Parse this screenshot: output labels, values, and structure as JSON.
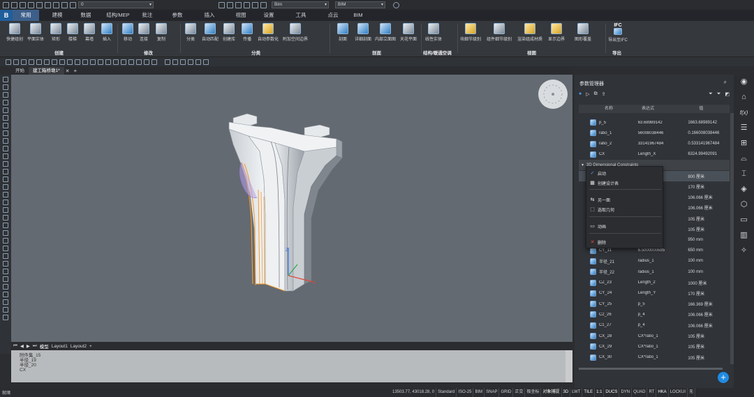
{
  "qat": {
    "layer_value": "0",
    "bim_value": "Bim",
    "workspace_value": "BIM"
  },
  "menu_tabs": [
    {
      "label": "常用",
      "active": true
    },
    {
      "label": "建模"
    },
    {
      "label": "数据"
    },
    {
      "label": "结构/MEP"
    },
    {
      "label": "批注"
    },
    {
      "label": "参数"
    },
    {
      "label": "插入"
    },
    {
      "label": "视图"
    },
    {
      "label": "设置"
    },
    {
      "label": "工具"
    },
    {
      "label": "点云"
    },
    {
      "label": "BIM"
    }
  ],
  "ribbon": {
    "buttons": [
      "快捷组创",
      "平面实体",
      "矩形",
      "楼梯",
      "幕墙",
      "插入",
      "移动",
      "连接",
      "复制",
      "分类",
      "自动匹配",
      "创建库",
      "传播",
      "自动参数化",
      "附加空间边界",
      "剖面",
      "详细剖面",
      "内部立面图",
      "天花平面",
      "线性实体",
      "块细节级别",
      "组件细节级别",
      "渲染组成材质",
      "显示边界",
      "图形覆盖",
      "导出至IFC"
    ],
    "groups": [
      "创建",
      "修改",
      "分类",
      "剖面",
      "结构/暖通空调",
      "视图",
      "导出"
    ],
    "ifc_label": "IFC"
  },
  "doc_tabs": [
    {
      "label": "开始"
    },
    {
      "label": "建工箱桥墩1*",
      "active": true
    }
  ],
  "layout_tabs": [
    "模型",
    "Layout1",
    "Layout2"
  ],
  "command_lines": [
    "附件集_15",
    "半径_19",
    "半径_20",
    "CX"
  ],
  "status": {
    "left": "就绪",
    "coords": "13503.77, 43018.28, 0",
    "items": [
      "Standard",
      "ISO-25",
      "BIM",
      "SNAP",
      "GRID",
      "正交",
      "极坐标",
      "对象捕捉",
      "3D",
      "LWT",
      "TILE",
      "1:1",
      "DUCS",
      "DYN",
      "QUAD",
      "RT",
      "HKA",
      "LOCKUI",
      "无"
    ]
  },
  "panel": {
    "title": "参数管理器",
    "headers": [
      "名称",
      "表达式",
      "值"
    ],
    "rows": [
      {
        "name": "p_5",
        "expr": "63.68989142",
        "value": "1663.68989142"
      },
      {
        "name": "ratio_1",
        "expr": "56008038446",
        "value": "0.166008038446"
      },
      {
        "name": "ratio_2",
        "expr": "33141967484",
        "value": "0.533141967484"
      },
      {
        "name": "CX",
        "expr": "Length_X",
        "value": "6324.99492091"
      },
      {
        "name": "3D Dimensional Constraints",
        "expr": "",
        "value": "",
        "group": true
      },
      {
        "name": "",
        "expr": "",
        "value": "800 厘米"
      },
      {
        "name": "",
        "expr": "",
        "value": "170 厘米"
      },
      {
        "name": "",
        "expr": "",
        "value": "106.066 厘米"
      },
      {
        "name": "",
        "expr": "",
        "value": "106.066 厘米"
      },
      {
        "name": "",
        "expr": "1",
        "value": "105 厘米"
      },
      {
        "name": "",
        "expr": "1",
        "value": "105 厘米"
      },
      {
        "name": "",
        "expr": "",
        "value": "950 mm"
      },
      {
        "name": "CY_11",
        "expr": "6.5000000685",
        "value": "650 mm"
      },
      {
        "name": "半径_21",
        "expr": "radius_1",
        "value": "100 mm"
      },
      {
        "name": "半径_22",
        "expr": "radius_1",
        "value": "100 mm"
      },
      {
        "name": "CZ_23",
        "expr": "Length_2",
        "value": "1000 厘米"
      },
      {
        "name": "CY_24",
        "expr": "Length_Y",
        "value": "170 厘米"
      },
      {
        "name": "CY_25",
        "expr": "p_5",
        "value": "166.369 厘米"
      },
      {
        "name": "C2_26",
        "expr": "p_4",
        "value": "106.066 厘米"
      },
      {
        "name": "C1_27",
        "expr": "p_4",
        "value": "106.066 厘米"
      },
      {
        "name": "CX_28",
        "expr": "CX*ratio_1",
        "value": "105 厘米"
      },
      {
        "name": "CX_29",
        "expr": "CX*ratio_1",
        "value": "105 厘米"
      },
      {
        "name": "CX_30",
        "expr": "CX*ratio_1",
        "value": "105 厘米"
      }
    ]
  },
  "context_menu": [
    {
      "label": "启动",
      "icon": "check-icon"
    },
    {
      "label": "创建设计表",
      "icon": "table-icon"
    },
    {
      "label": "另一面",
      "icon": "flip-icon"
    },
    {
      "label": "选取几何",
      "icon": "select-icon"
    },
    {
      "label": "动画",
      "icon": "animation-icon"
    },
    {
      "label": "删除",
      "icon": "delete-icon"
    }
  ],
  "colors": {
    "accent": "#1f8be3",
    "ribbon": "#35383c",
    "viewport": "#646a71",
    "command": "#b8bbbd"
  }
}
